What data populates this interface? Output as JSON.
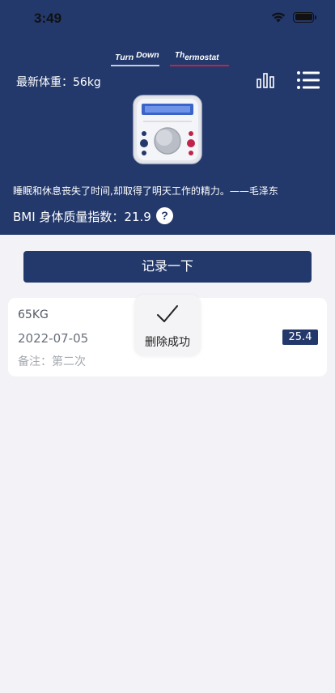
{
  "status_bar": {
    "time": "3:49"
  },
  "logo": {
    "left_main": "Turn ",
    "left_sup": "Down",
    "right_sup": "Th",
    "right_main": "ermostat"
  },
  "header": {
    "latest_weight": "最新体重：56kg",
    "quote": "睡眠和休息丧失了时间,却取得了明天工作的精力。——毛泽东",
    "bmi_text": "BMI 身体质量指数：21.9",
    "help_label": "?"
  },
  "actions": {
    "record_label": "记录一下"
  },
  "records": [
    {
      "weight": "65KG",
      "date": "2022-07-05",
      "note": "备注：第二次",
      "bmi": "25.4"
    }
  ],
  "toast": {
    "message": "删除成功"
  },
  "colors": {
    "primary": "#23386b",
    "background": "#f2f2f7",
    "accent_red": "#c0244a"
  },
  "icons": [
    "wifi-icon",
    "battery-icon",
    "bar-chart-icon",
    "list-menu-icon",
    "thermostat-device-icon",
    "help-icon",
    "checkmark-icon"
  ]
}
